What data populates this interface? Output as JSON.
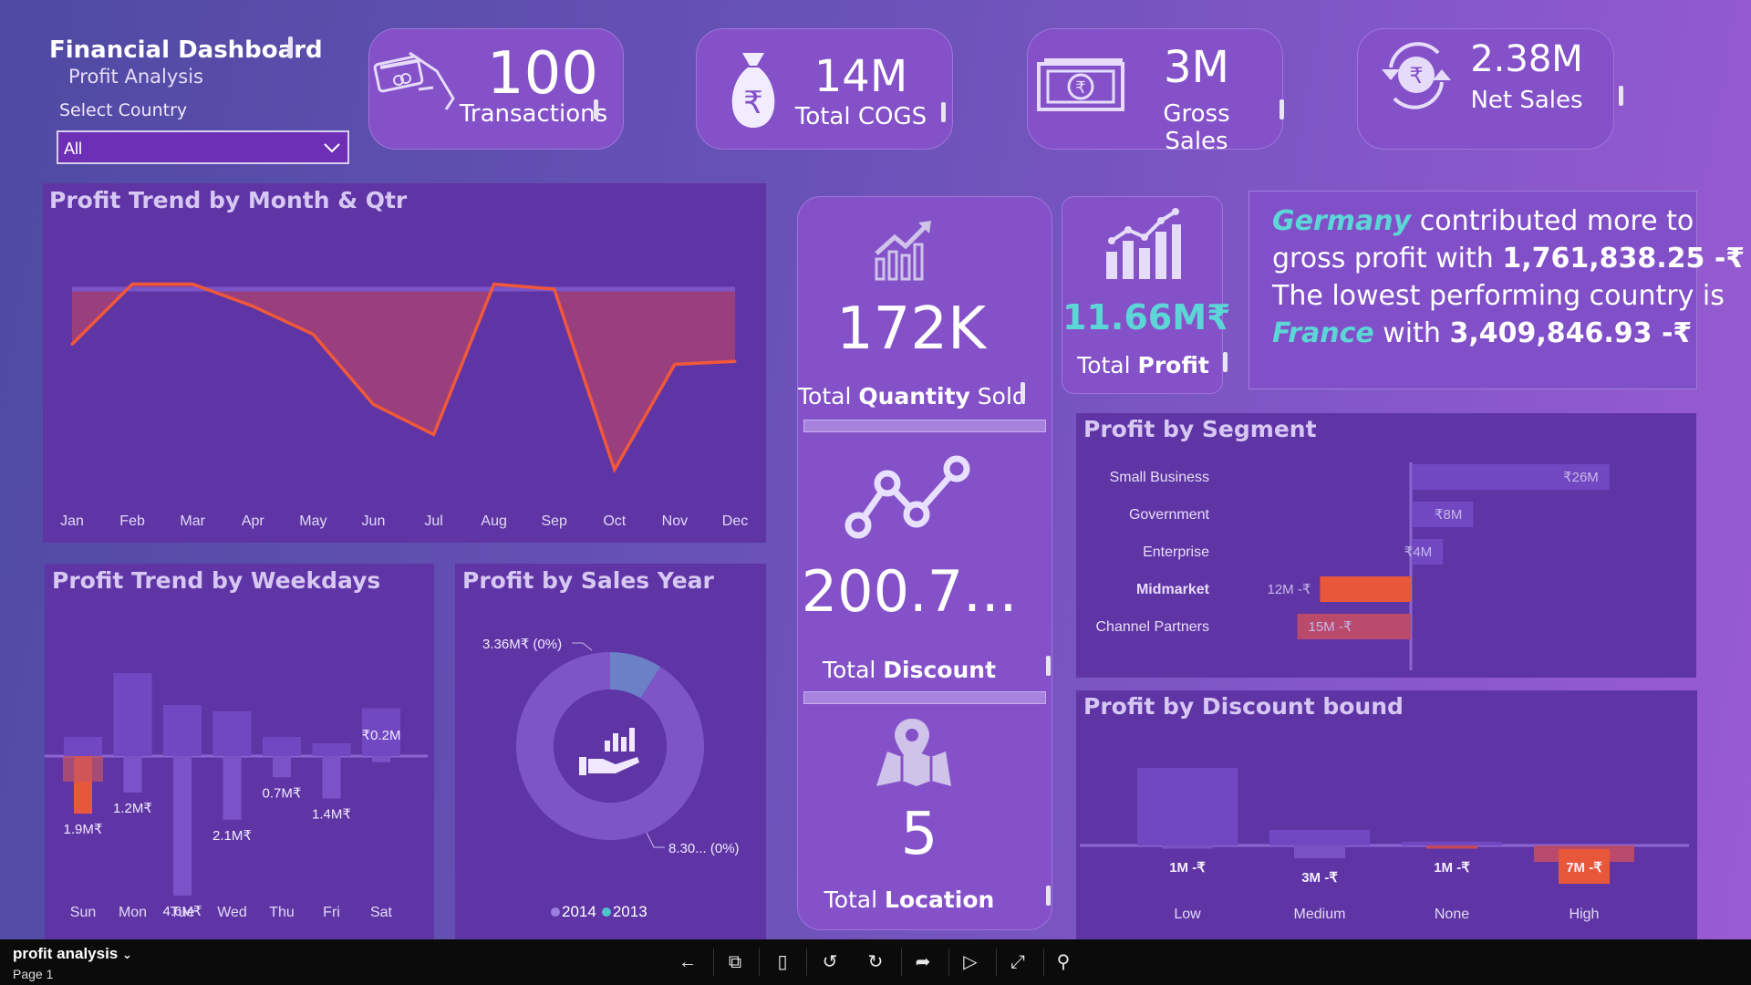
{
  "header": {
    "title": "Financial Dashboard",
    "subtitle": "Profit Analysis",
    "filter_label": "Select Country",
    "filter_value": "All"
  },
  "kpis": [
    {
      "value": "100",
      "label": "Transactions",
      "icon": "card-hand-icon"
    },
    {
      "value": "14M",
      "label": "Total COGS",
      "icon": "money-bag-rupee-icon"
    },
    {
      "value": "3M",
      "label": "Gross Sales",
      "icon": "banknote-icon"
    },
    {
      "value": "2.38M",
      "label": "Net Sales",
      "icon": "rupee-refresh-icon"
    }
  ],
  "side_kpis": {
    "quantity": {
      "value": "172K",
      "label_pre": "Total ",
      "label_bold": "Quantity",
      "label_post": " Sold"
    },
    "discount": {
      "value": "200.7...",
      "label_pre": "Total ",
      "label_bold": "Discount"
    },
    "location": {
      "value": "5",
      "label_pre": "Total ",
      "label_bold": "Location"
    },
    "profit": {
      "value": "11.66M₹",
      "label_pre": "Total ",
      "label_bold": "Profit"
    }
  },
  "insight": {
    "top_country": "Germany",
    "line1_rest": " contributed more to",
    "line2_pre": "gross profit with ",
    "top_value": "1,761,838.25 -₹",
    "line3": "The lowest performing country is",
    "low_country": "France",
    "with": " with ",
    "low_value": "3,409,846.93 -₹"
  },
  "colors": {
    "accent_red": "#e8573a",
    "teal": "#5cd6d6",
    "panel": "#5f35a5",
    "card": "#8451c9"
  },
  "monthly": {
    "title": "Profit Trend by Month & Qtr",
    "months": [
      "Jan",
      "Feb",
      "Mar",
      "Apr",
      "May",
      "Jun",
      "Jul",
      "Aug",
      "Sep",
      "Oct",
      "Nov",
      "Dec"
    ],
    "baseline": [
      0.0,
      0.0,
      0.0,
      0.0,
      0.0,
      0.0,
      0.0,
      0.0,
      0.0,
      0.0,
      0.0,
      0.0
    ],
    "profit": [
      -0.55,
      0.05,
      0.05,
      -0.17,
      -0.45,
      -1.15,
      -1.45,
      0.05,
      0.0,
      -1.8,
      -0.75,
      -0.72
    ]
  },
  "weekdays": {
    "title": "Profit Trend by Weekdays",
    "days": [
      "Sun",
      "Mon",
      "Tue",
      "Wed",
      "Thu",
      "Fri",
      "Sat"
    ],
    "bars": [
      0.6,
      2.6,
      1.6,
      1.4,
      0.6,
      0.4,
      1.5
    ],
    "neg": [
      1.9,
      1.2,
      4.6,
      2.1,
      0.7,
      1.4,
      0.2
    ],
    "labels": [
      "1.9M₹",
      "1.2M₹",
      "4.6M₹",
      "2.1M₹",
      "0.7M₹",
      "1.4M₹",
      "₹0.2M"
    ]
  },
  "sales_year": {
    "title": "Profit by Sales Year",
    "slices": [
      {
        "name": "2014",
        "label": "8.30... (0%)",
        "color": "#7e55c6",
        "value": 8.3
      },
      {
        "name": "2013",
        "label": "3.36M₹ (0%)",
        "color": "#6c80c7",
        "value": 3.36
      }
    ],
    "legend": [
      "2014",
      "2013"
    ],
    "legend_colors": [
      "#9b7ee0",
      "#4fc4cf"
    ]
  },
  "segment": {
    "title": "Profit by Segment",
    "items": [
      {
        "name": "Small Business",
        "value": 26,
        "label": "₹26M",
        "bold": false
      },
      {
        "name": "Government",
        "value": 8,
        "label": "₹8M",
        "bold": false
      },
      {
        "name": "Enterprise",
        "value": 4,
        "label": "₹4M",
        "bold": false
      },
      {
        "name": "Midmarket",
        "value": -12,
        "label": "12M -₹",
        "bold": true
      },
      {
        "name": "Channel Partners",
        "value": -15,
        "label": "15M -₹",
        "bold": false
      }
    ]
  },
  "discount": {
    "title": "Profit by Discount bound",
    "bands": [
      "Low",
      "Medium",
      "None",
      "High"
    ],
    "bars": [
      1.0,
      0.2,
      0.05,
      0.0
    ],
    "neg": [
      0.05,
      0.2,
      0.05,
      0.45
    ],
    "labels": [
      "1M -₹",
      "3M -₹",
      "1M -₹",
      "7M -₹"
    ],
    "highlight": 3
  },
  "footer": {
    "page_name": "profit analysis",
    "page_num": "Page 1"
  }
}
